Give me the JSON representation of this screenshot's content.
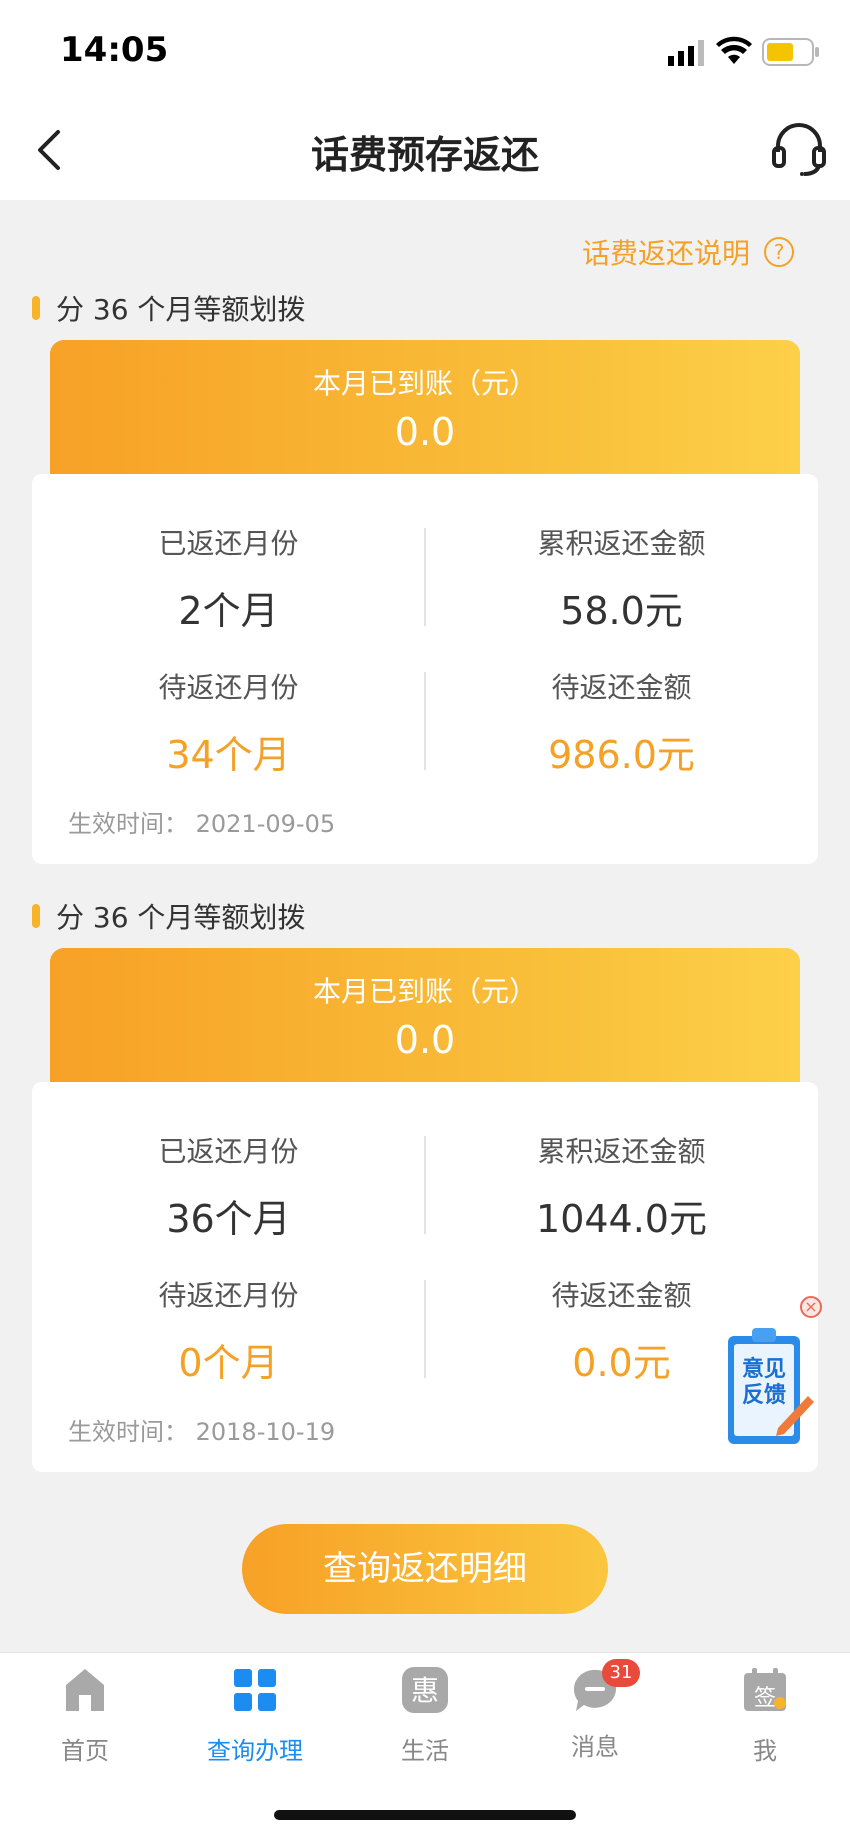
{
  "status_bar": {
    "time": "14:05"
  },
  "header": {
    "title": "话费预存返还"
  },
  "help_link": {
    "label": "话费返还说明",
    "icon": "?"
  },
  "plans": [
    {
      "section_title": "分 36 个月等额划拨",
      "banner_label": "本月已到账（元）",
      "banner_value": "0.0",
      "returned_months_label": "已返还月份",
      "returned_months_value": "2个月",
      "returned_amount_label": "累积返还金额",
      "returned_amount_value": "58.0元",
      "pending_months_label": "待返还月份",
      "pending_months_value": "34个月",
      "pending_amount_label": "待返还金额",
      "pending_amount_value": "986.0元",
      "effective_time": "生效时间：  2021-09-05"
    },
    {
      "section_title": "分 36 个月等额划拨",
      "banner_label": "本月已到账（元）",
      "banner_value": "0.0",
      "returned_months_label": "已返还月份",
      "returned_months_value": "36个月",
      "returned_amount_label": "累积返还金额",
      "returned_amount_value": "1044.0元",
      "pending_months_label": "待返还月份",
      "pending_months_value": "0个月",
      "pending_amount_label": "待返还金额",
      "pending_amount_value": "0.0元",
      "effective_time": "生效时间：  2018-10-19"
    }
  ],
  "feedback": {
    "line1": "意见",
    "line2": "反馈",
    "close": "×"
  },
  "query_button": {
    "label": "查询返还明细"
  },
  "tabs": [
    {
      "label": "首页",
      "icon": "home-icon"
    },
    {
      "label": "查询办理",
      "icon": "grid-icon"
    },
    {
      "label": "生活",
      "icon": "hui-icon",
      "glyph": "惠"
    },
    {
      "label": "消息",
      "icon": "message-icon",
      "badge": "31"
    },
    {
      "label": "我",
      "icon": "calendar-sign-icon",
      "glyph": "签"
    }
  ],
  "colors": {
    "accent": "#f5a125",
    "active_tab": "#1a8cf2",
    "badge": "#e94a3a"
  }
}
